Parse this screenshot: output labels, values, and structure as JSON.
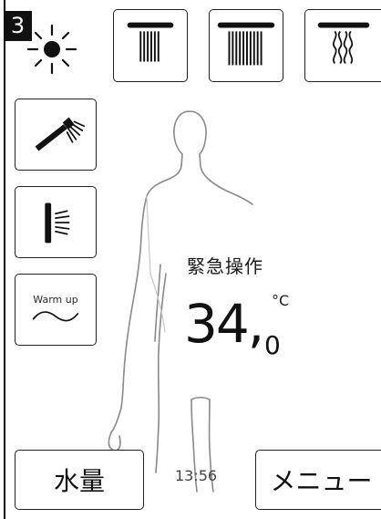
{
  "step_number": "3",
  "status_text": "緊急操作",
  "temperature": {
    "main": "34,",
    "decimal": "0",
    "unit": "°C"
  },
  "warmup_label": "Warm up",
  "bottom": {
    "left_button": "水量",
    "time": "13:56",
    "right_button": "メニュー"
  },
  "icons": {
    "sun": "sun-icon",
    "rain_small": "rain-shower-small-icon",
    "rain_large": "rain-shower-large-icon",
    "waterfall": "waterfall-shower-icon",
    "hand_shower": "hand-shower-icon",
    "side_jet": "side-jet-icon",
    "warmup_wave": "warm-up-wave-icon"
  },
  "colors": {
    "text": "#111111",
    "border": "#222222",
    "badge_background": "#111111",
    "badge_text": "#ffffff"
  }
}
